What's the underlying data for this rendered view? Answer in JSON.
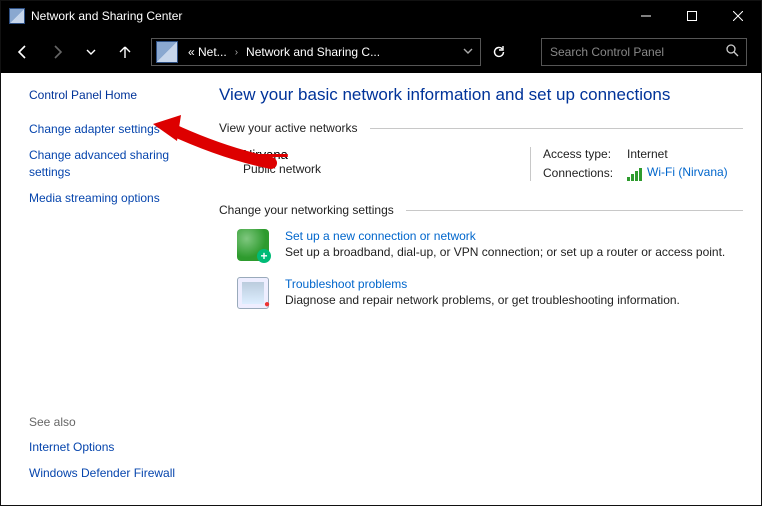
{
  "window": {
    "title": "Network and Sharing Center"
  },
  "breadcrumbs": {
    "b1": "« Net...",
    "b2": "Network and Sharing C..."
  },
  "search": {
    "placeholder": "Search Control Panel"
  },
  "sidebar": {
    "home": "Control Panel Home",
    "adapter": "Change adapter settings",
    "advanced": "Change advanced sharing settings",
    "media": "Media streaming options",
    "seealso_hdr": "See also",
    "internet_opts": "Internet Options",
    "firewall": "Windows Defender Firewall"
  },
  "main": {
    "heading": "View your basic network information and set up connections",
    "active_hdr": "View your active networks",
    "network": {
      "name": "Nirvana",
      "type": "Public network",
      "access_lbl": "Access type:",
      "access_val": "Internet",
      "conn_lbl": "Connections:",
      "conn_val": "Wi-Fi (Nirvana)"
    },
    "change_hdr": "Change your networking settings",
    "opt1_title": "Set up a new connection or network",
    "opt1_desc": "Set up a broadband, dial-up, or VPN connection; or set up a router or access point.",
    "opt2_title": "Troubleshoot problems",
    "opt2_desc": "Diagnose and repair network problems, or get troubleshooting information."
  }
}
